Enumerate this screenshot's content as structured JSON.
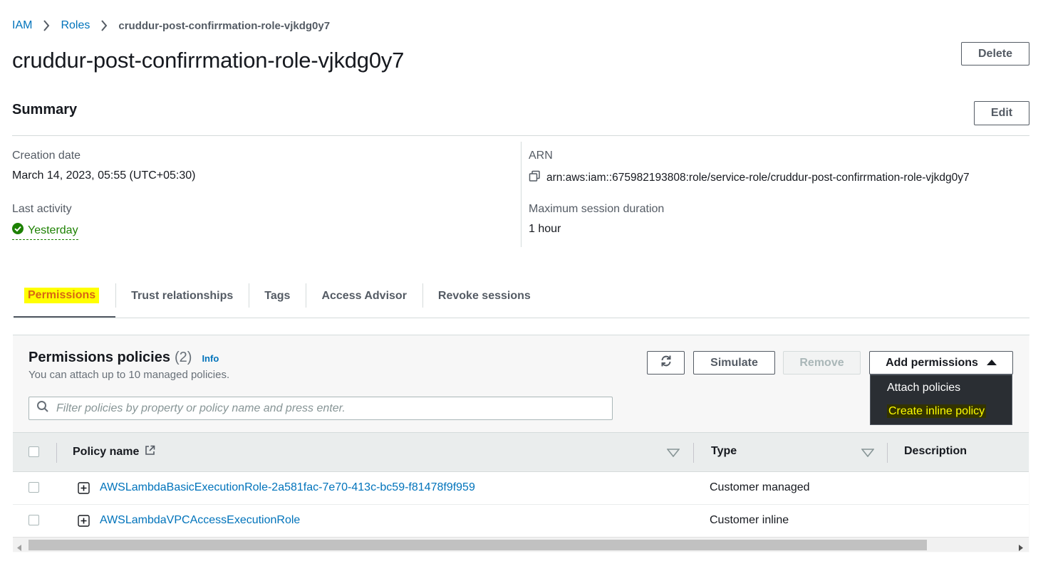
{
  "breadcrumb": {
    "items": [
      "IAM",
      "Roles"
    ],
    "current": "cruddur-post-confirrmation-role-vjkdg0y7"
  },
  "page": {
    "title": "cruddur-post-confirrmation-role-vjkdg0y7",
    "delete_label": "Delete"
  },
  "summary": {
    "title": "Summary",
    "edit_label": "Edit",
    "creation_date_label": "Creation date",
    "creation_date": "March 14, 2023, 05:55 (UTC+05:30)",
    "last_activity_label": "Last activity",
    "last_activity": "Yesterday",
    "arn_label": "ARN",
    "arn": "arn:aws:iam::675982193808:role/service-role/cruddur-post-confirrmation-role-vjkdg0y7",
    "max_session_label": "Maximum session duration",
    "max_session": "1 hour"
  },
  "tabs": [
    {
      "label": "Permissions",
      "active": true
    },
    {
      "label": "Trust relationships",
      "active": false
    },
    {
      "label": "Tags",
      "active": false
    },
    {
      "label": "Access Advisor",
      "active": false
    },
    {
      "label": "Revoke sessions",
      "active": false
    }
  ],
  "permissions": {
    "title": "Permissions policies",
    "count": "(2)",
    "info_label": "Info",
    "description": "You can attach up to 10 managed policies.",
    "search_placeholder": "Filter policies by property or policy name and press enter.",
    "simulate_label": "Simulate",
    "remove_label": "Remove",
    "add_permissions_label": "Add permissions",
    "dropdown": [
      "Attach policies",
      "Create inline policy"
    ]
  },
  "table": {
    "columns": [
      "Policy name",
      "Type",
      "Description"
    ],
    "rows": [
      {
        "name": "AWSLambdaBasicExecutionRole-2a581fac-7e70-413c-bc59-f81478f9f959",
        "type": "Customer managed",
        "description": ""
      },
      {
        "name": "AWSLambdaVPCAccessExecutionRole",
        "type": "Customer inline",
        "description": ""
      }
    ]
  },
  "colors": {
    "link": "#0073bb",
    "success": "#1d8102",
    "active_tab": "#ec7211",
    "highlight": "#ffff00",
    "dropdown_bg": "#2a2e33"
  },
  "icons": [
    "chevron-right-icon",
    "copy-icon",
    "check-circle-icon",
    "refresh-icon",
    "caret-up-icon",
    "search-icon",
    "external-link-icon",
    "sort-caret-icon",
    "expand-plus-icon"
  ]
}
